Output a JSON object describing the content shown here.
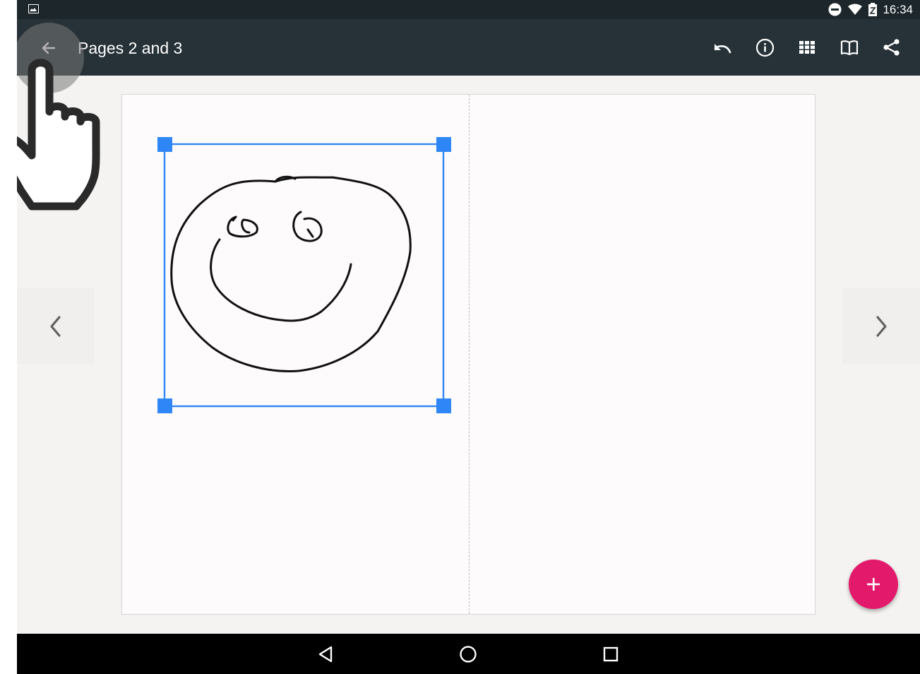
{
  "status_bar": {
    "time": "16:34",
    "icons": [
      "image-notification-icon",
      "do-not-disturb-icon",
      "wifi-icon",
      "battery-icon"
    ]
  },
  "app_bar": {
    "title": "Pages 2 and 3",
    "back_icon": "arrow-back-icon",
    "actions": [
      "undo-icon",
      "info-icon",
      "grid-view-icon",
      "book-icon",
      "share-icon"
    ],
    "background": "#263238"
  },
  "canvas": {
    "drawing": "smiley-face-sketch",
    "selection_color": "#2f86f6"
  },
  "navigation": {
    "prev_icon": "chevron-left-icon",
    "next_icon": "chevron-right-icon"
  },
  "fab": {
    "icon": "plus-icon",
    "color": "#e3196b"
  },
  "system_nav": {
    "buttons": [
      "back-triangle-icon",
      "home-circle-icon",
      "recents-square-icon"
    ]
  },
  "overlay": {
    "icon": "touch-hand-icon"
  }
}
